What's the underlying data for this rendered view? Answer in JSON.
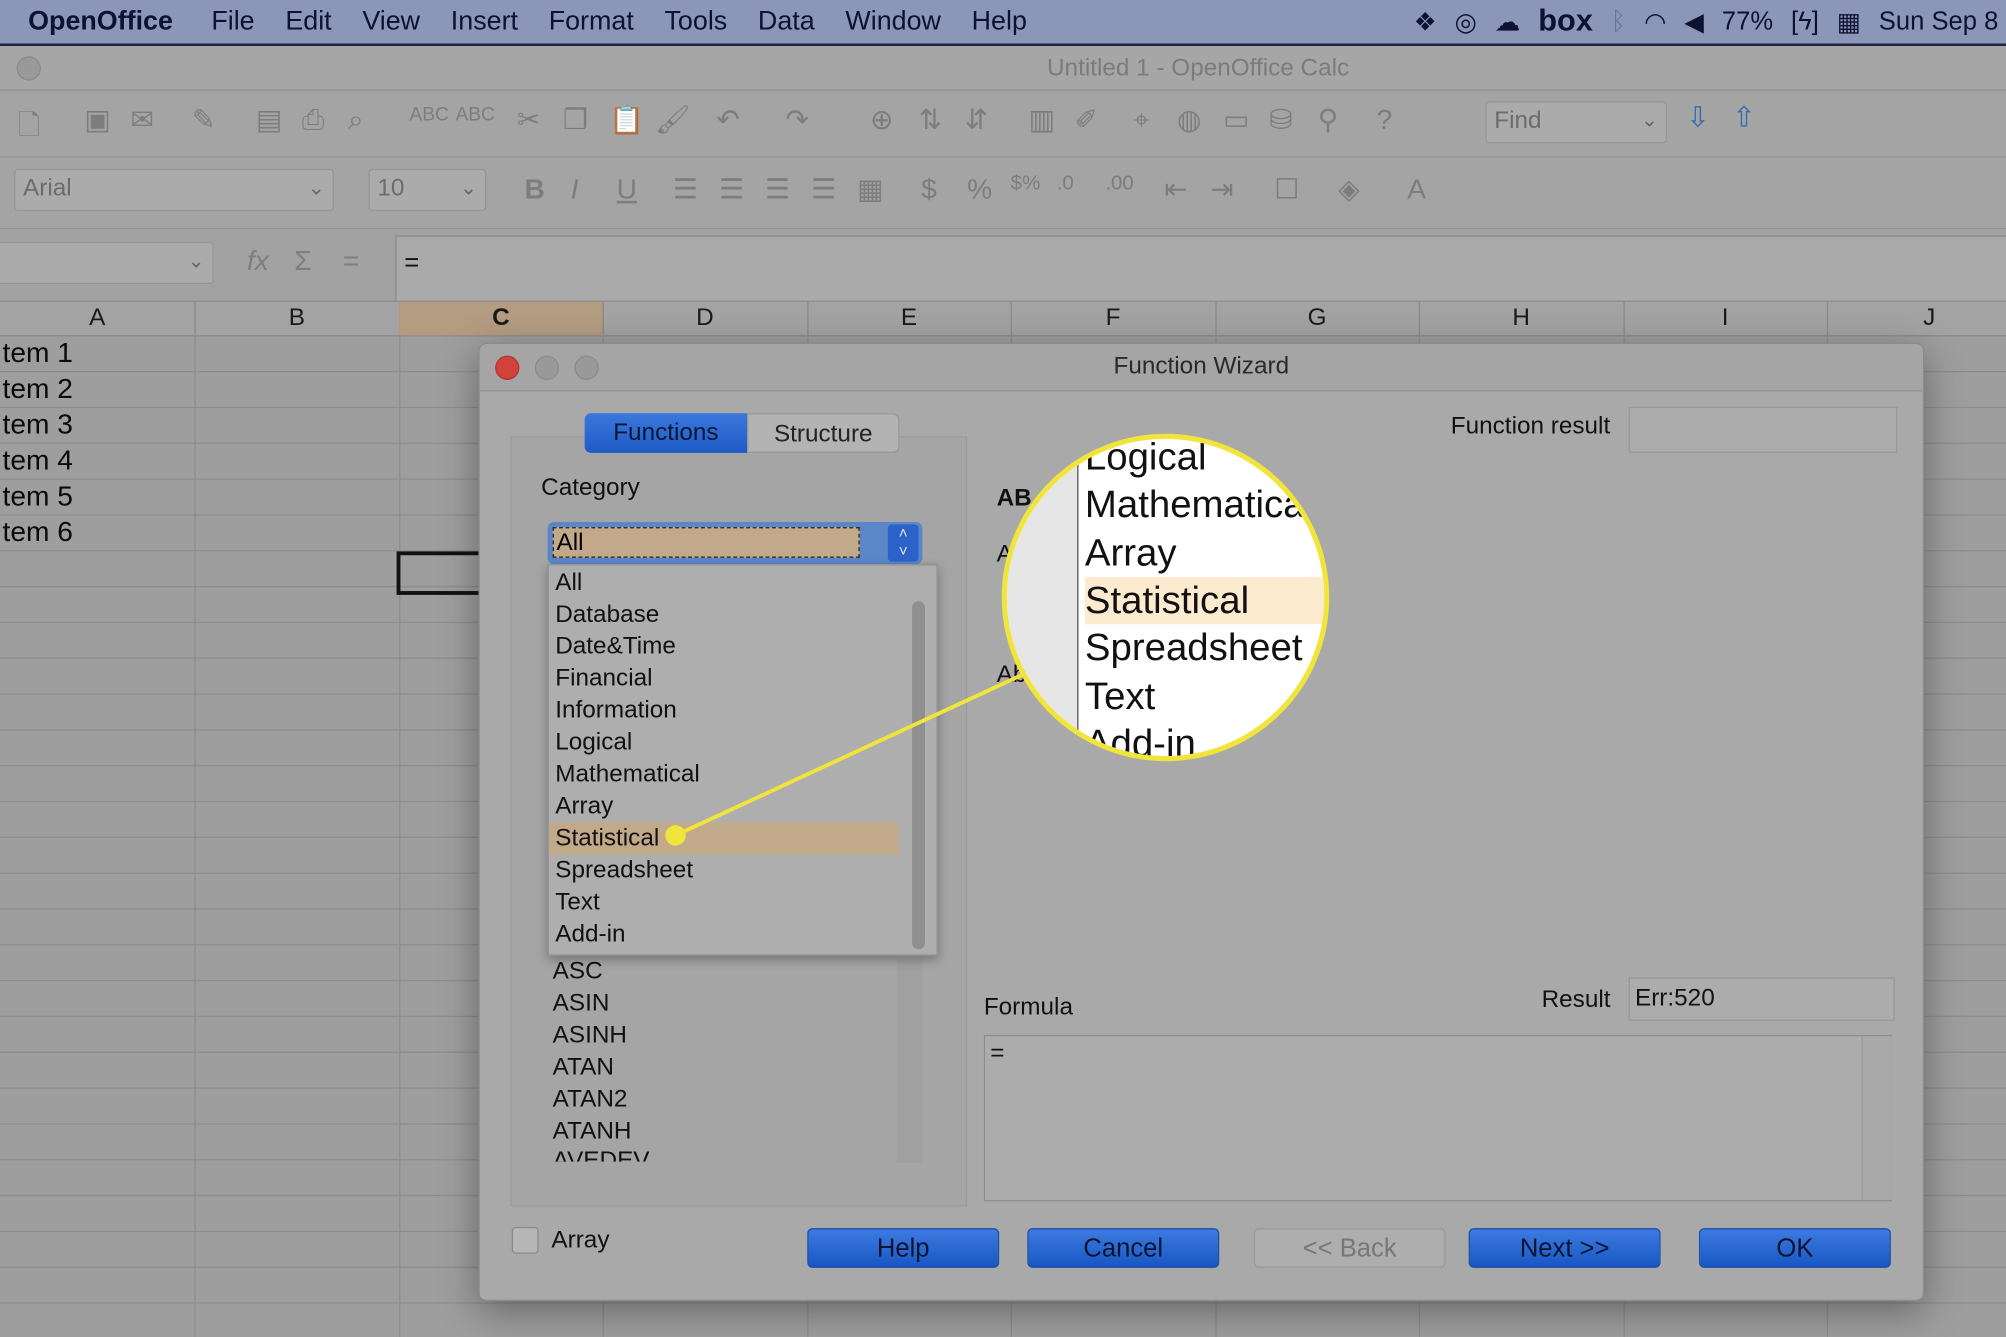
{
  "menubar": {
    "app": "OpenOffice",
    "items": [
      "File",
      "Edit",
      "View",
      "Insert",
      "Format",
      "Tools",
      "Data",
      "Window",
      "Help"
    ],
    "status": {
      "icons": [
        "dropbox-icon",
        "creative-cloud-icon",
        "cloud-upload-icon",
        "bluetooth-icon",
        "wifi-icon",
        "volume-icon",
        "battery-charging-icon",
        "calendar-icon"
      ],
      "box": "box",
      "battery": "77%",
      "clock": "Sun Sep 8"
    }
  },
  "window": {
    "title": "Untitled 1 - OpenOffice Calc"
  },
  "toolbar": {
    "find_placeholder": "Find",
    "font_name": "Arial",
    "font_size": "10"
  },
  "formula_bar": {
    "name_box": "",
    "content": "="
  },
  "sheet": {
    "columns": [
      "A",
      "B",
      "C",
      "D",
      "E",
      "F",
      "G",
      "H",
      "I",
      "J"
    ],
    "selected_column": "C",
    "cells_col_a": [
      "tem 1",
      "tem 2",
      "tem 3",
      "tem 4",
      "tem 5",
      "tem 6"
    ]
  },
  "dialog": {
    "title": "Function Wizard",
    "tabs": [
      {
        "label": "Functions",
        "active": true
      },
      {
        "label": "Structure",
        "active": false
      }
    ],
    "category_label": "Category",
    "category_value": "All",
    "category_options": [
      "All",
      "Database",
      "Date&Time",
      "Financial",
      "Information",
      "Logical",
      "Mathematical",
      "Array",
      "Statistical",
      "Spreadsheet",
      "Text",
      "Add-in"
    ],
    "highlighted_option": "Statistical",
    "functions": [
      "ASC",
      "ASIN",
      "ASINH",
      "ATAN",
      "ATAN2",
      "ATANH",
      "AVEDEV"
    ],
    "function_result_label": "Function result",
    "function_result": "",
    "partial_labels": [
      "AB",
      "A",
      "Ab"
    ],
    "formula_label": "Formula",
    "formula": "=",
    "result_label": "Result",
    "result": "Err:520",
    "array_label": "Array",
    "array_checked": false,
    "buttons": {
      "help": "Help",
      "cancel": "Cancel",
      "back": "<< Back",
      "next": "Next >>",
      "ok": "OK"
    }
  },
  "magnifier": {
    "items": [
      "Logical",
      "Mathematica",
      "Array",
      "Statistical",
      "Spreadsheet",
      "Text",
      "Add-in"
    ],
    "highlighted": "Statistical",
    "highlight_color": "#fdebd0",
    "ring_color": "#f1e43a"
  },
  "colors": {
    "accent": "#1f5fcc",
    "selection": "#c2a98a"
  }
}
